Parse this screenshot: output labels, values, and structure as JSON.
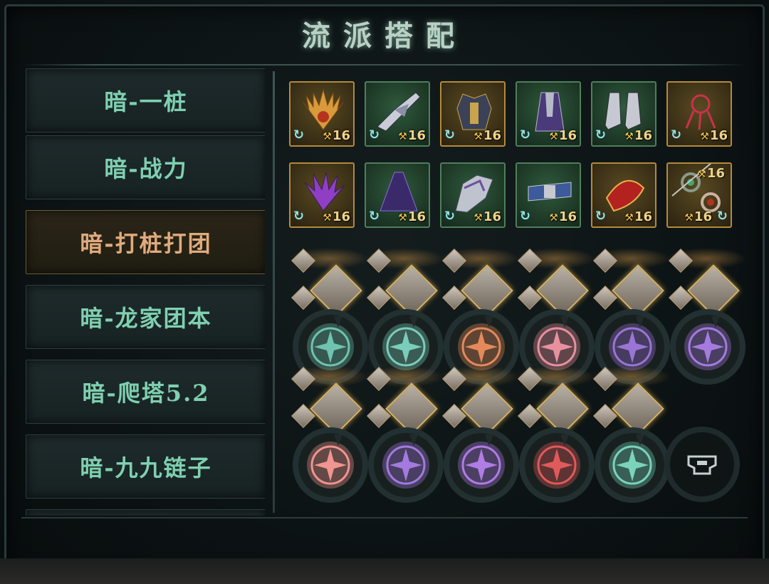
{
  "header": {
    "title": "流派搭配"
  },
  "sidebar": {
    "tabs": [
      {
        "label": "暗-一桩"
      },
      {
        "label": "暗-战力"
      },
      {
        "label": "暗-打桩打团",
        "active": true
      },
      {
        "label": "暗-龙家团本"
      },
      {
        "label": "暗-爬塔5.2"
      },
      {
        "label": "暗-九九链子"
      }
    ]
  },
  "equipment": {
    "row1": [
      {
        "icon": "wing-icon",
        "frame": "gold",
        "level": "16"
      },
      {
        "icon": "gauntlet-icon",
        "frame": "green",
        "level": "16"
      },
      {
        "icon": "armor-icon",
        "frame": "gold",
        "level": "16"
      },
      {
        "icon": "robe-icon",
        "frame": "green",
        "level": "16"
      },
      {
        "icon": "boots-icon",
        "frame": "green",
        "level": "16"
      },
      {
        "icon": "claw-icon",
        "frame": "gold",
        "level": "16"
      }
    ],
    "row2": [
      {
        "icon": "purple-plume-icon",
        "frame": "gold",
        "level": "16"
      },
      {
        "icon": "purple-cloak-icon",
        "frame": "green",
        "level": "16"
      },
      {
        "icon": "silver-gauntlet-icon",
        "frame": "green",
        "level": "16"
      },
      {
        "icon": "blue-belt-icon",
        "frame": "green",
        "level": "16"
      },
      {
        "icon": "red-amulet-icon",
        "frame": "gold",
        "level": "16"
      },
      {
        "icon": "ring-pair-icon",
        "frame": "gold",
        "level": "16",
        "level2": "16"
      }
    ]
  },
  "teams": {
    "row1": [
      {
        "emblem_color": "#6fc3b0"
      },
      {
        "emblem_color": "#7bcdbb"
      },
      {
        "emblem_color": "#e48a5a"
      },
      {
        "emblem_color": "#e8909f"
      },
      {
        "emblem_color": "#9a74d6"
      },
      {
        "emblem_color": "#a57be0"
      }
    ],
    "row2": [
      {
        "emblem_color": "#f0958f"
      },
      {
        "emblem_color": "#a47adf"
      },
      {
        "emblem_color": "#b07ce6"
      },
      {
        "emblem_color": "#e05a5a"
      },
      {
        "emblem_color": "#79d4bb"
      }
    ],
    "empty_slot_icon": "empty-armor-slot-icon"
  },
  "colors": {
    "tab_text": "#7fd0b0",
    "tab_active_text": "#e1ab7d",
    "gold_frame": "#b48a3b",
    "green_frame": "#4f7f5b",
    "level_text": "#f0d38a",
    "refresh_icon": "#8fe3ea"
  }
}
